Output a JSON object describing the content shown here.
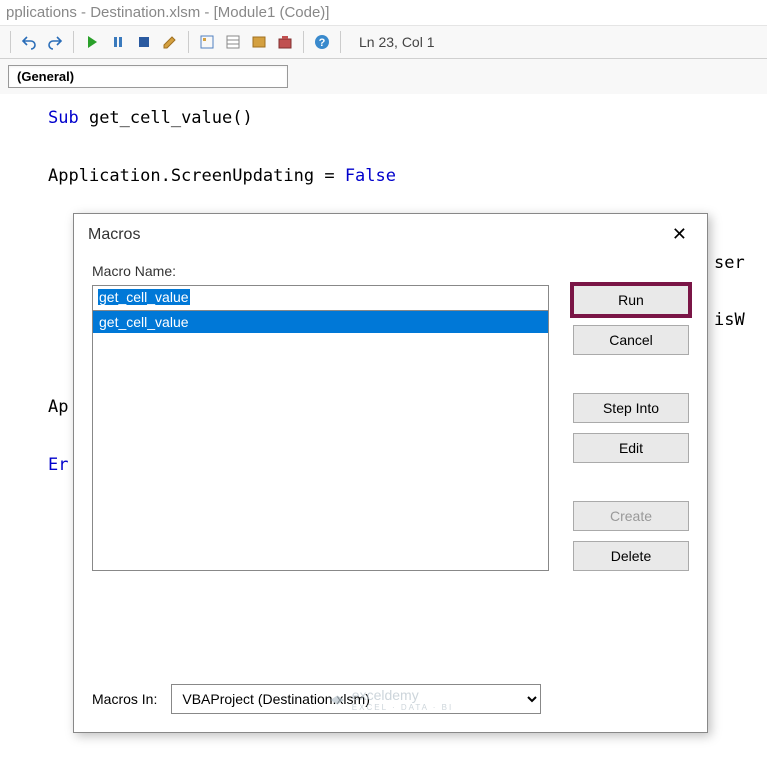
{
  "title": "pplications - Destination.xlsm - [Module1 (Code)]",
  "cursor_pos": "Ln 23, Col 1",
  "general_dropdown": "(General)",
  "code": {
    "line1_kw": "Sub",
    "line1_rest": " get_cell_value()",
    "line2_lhs": "Application.ScreenUpdating = ",
    "line2_kw": "False",
    "behind1": "ser",
    "behind2": "isW",
    "partial_ap": "Ap",
    "partial_er": "Er"
  },
  "dialog": {
    "title": "Macros",
    "macro_name_label": "Macro Name:",
    "input_value": "get_cell_value",
    "list": [
      "get_cell_value"
    ],
    "buttons": {
      "run": "Run",
      "cancel": "Cancel",
      "step_into": "Step Into",
      "edit": "Edit",
      "create": "Create",
      "delete": "Delete"
    },
    "macros_in_label": "Macros In:",
    "macros_in_value": "VBAProject (Destination.xlsm)"
  },
  "watermark": {
    "brand": "exceldemy",
    "sub": "EXCEL · DATA · BI"
  }
}
